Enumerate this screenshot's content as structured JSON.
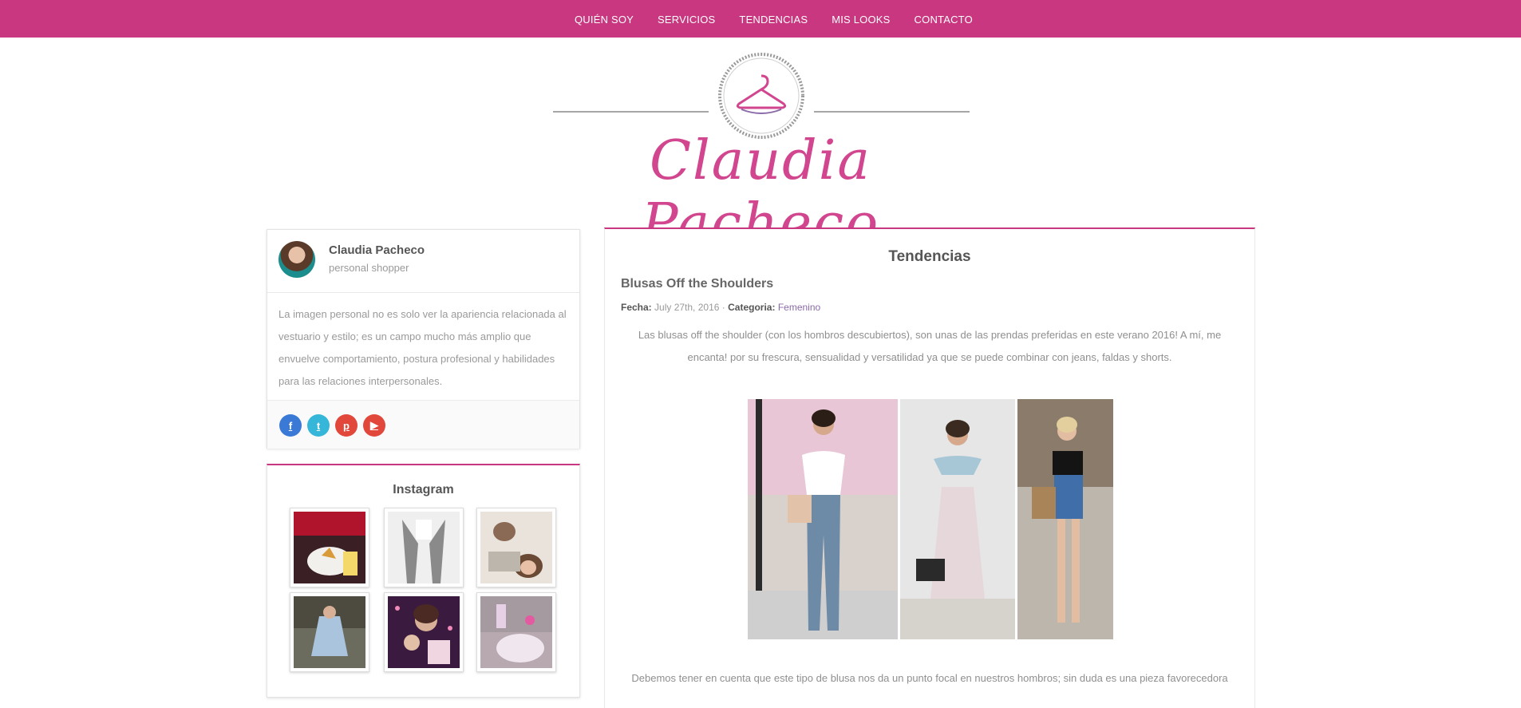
{
  "nav": {
    "items": [
      "QUIÉN SOY",
      "SERVICIOS",
      "TENDENCIAS",
      "MIS LOOKS",
      "CONTACTO"
    ]
  },
  "header": {
    "logo_text": "Claudia Pacheco",
    "icon": "hanger-icon"
  },
  "sidebar": {
    "profile": {
      "name": "Claudia Pacheco",
      "role": "personal shopper",
      "bio": "La imagen personal no es solo ver la apariencia relacionada al vestuario y estilo; es un campo mucho más amplio que envuelve comportamiento, postura profesional y habilidades para las relaciones interpersonales.",
      "social": [
        {
          "name": "facebook-icon",
          "glyph": "f"
        },
        {
          "name": "twitter-icon",
          "glyph": "t"
        },
        {
          "name": "pinterest-icon",
          "glyph": "p"
        },
        {
          "name": "youtube-icon",
          "glyph": "▶"
        }
      ]
    },
    "instagram": {
      "title": "Instagram"
    }
  },
  "main": {
    "section_title": "Tendencias",
    "post": {
      "title": "Blusas Off the Shoulders",
      "date_label": "Fecha:",
      "date": "July 27th, 2016",
      "separator": "·",
      "category_label": "Categoria:",
      "category": "Femenino",
      "intro": "Las blusas off the shoulder (con los hombros descubiertos), son unas de las prendas preferidas en este verano 2016! A mí, me encanta! por su frescura, sensualidad y versatilidad ya que se puede combinar con jeans, faldas y shorts.",
      "more": "Debemos tener en cuenta que este tipo de blusa nos da un punto focal en nuestros hombros; sin duda es una pieza favorecedora"
    }
  },
  "colors": {
    "brand": "#c8377f",
    "logo": "#d1468e"
  }
}
